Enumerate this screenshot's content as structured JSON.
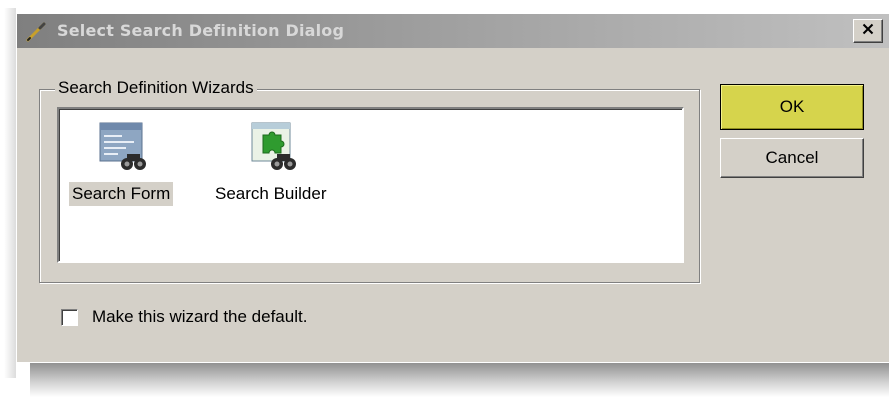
{
  "window": {
    "title": "Select Search Definition Dialog",
    "title_icon": "pencil-icon",
    "close_glyph": "×"
  },
  "group": {
    "label": "Search Definition Wizards",
    "items": [
      {
        "label": "Search Form",
        "icon": "search-form-icon",
        "selected": true
      },
      {
        "label": "Search Builder",
        "icon": "search-builder-icon",
        "selected": false
      }
    ]
  },
  "buttons": {
    "ok_label": "OK",
    "cancel_label": "Cancel"
  },
  "checkbox": {
    "label": "Make this wizard the default.",
    "checked": false
  },
  "colors": {
    "dialog_background": "#d4d0c8",
    "ok_button_highlight": "#d6d44c",
    "selection_background": "#d4d0c8"
  }
}
